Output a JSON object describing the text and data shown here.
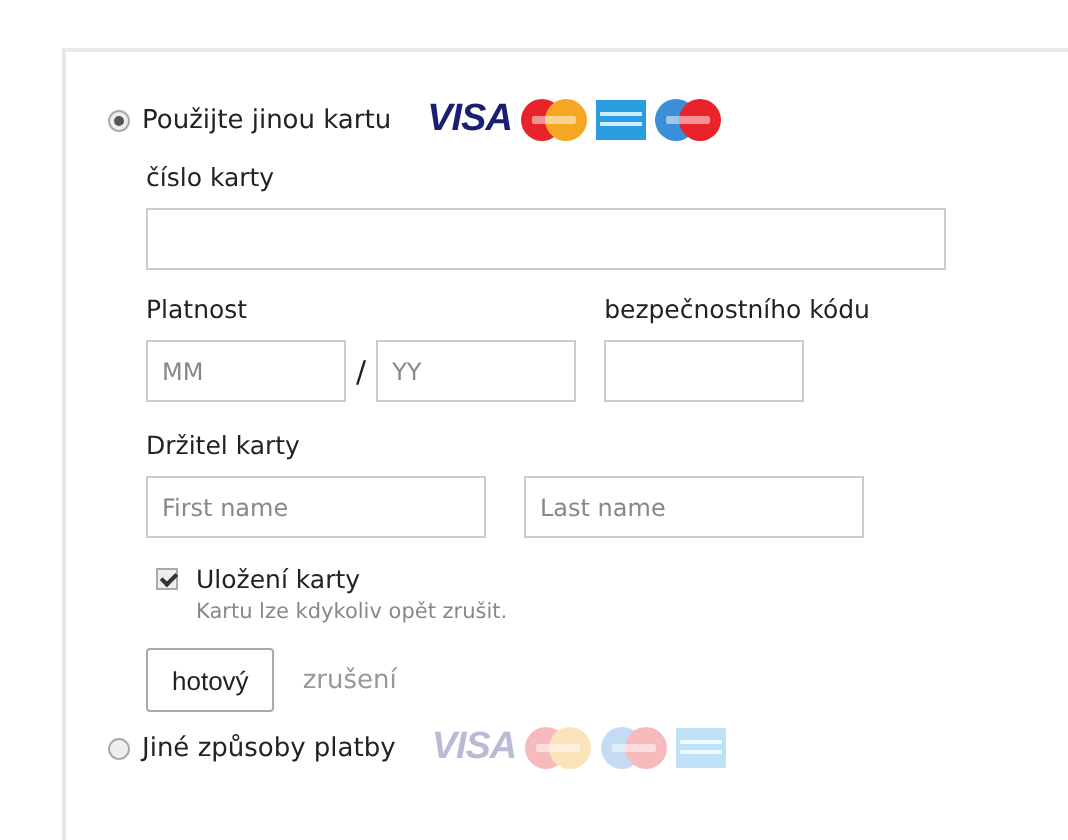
{
  "payment_options": [
    {
      "label": "Použijte jinou kartu",
      "selected": true,
      "dimmed_logos": false,
      "logos": [
        {
          "kind": "visa",
          "text": "VISA"
        },
        {
          "kind": "mastercard"
        },
        {
          "kind": "amex"
        },
        {
          "kind": "maestro"
        }
      ]
    },
    {
      "label": "Jiné způsoby platby",
      "selected": false,
      "dimmed_logos": true,
      "logos": [
        {
          "kind": "visa",
          "text": "VISA"
        },
        {
          "kind": "mastercard"
        },
        {
          "kind": "maestro"
        },
        {
          "kind": "amex"
        }
      ]
    }
  ],
  "card_number": {
    "label": "číslo karty"
  },
  "expiry": {
    "label": "Platnost",
    "month_placeholder": "MM",
    "separator": "/",
    "year_placeholder": "YY"
  },
  "security_code": {
    "label": "bezpečnostního kódu"
  },
  "cardholder": {
    "label": "Držitel karty",
    "first_placeholder": "First name",
    "last_placeholder": "Last name"
  },
  "save_card": {
    "label": "Uložení karty",
    "checked": true,
    "hint": "Kartu lze kdykoliv opět zrušit."
  },
  "buttons": {
    "done": "hotový",
    "cancel": "zrušení"
  }
}
